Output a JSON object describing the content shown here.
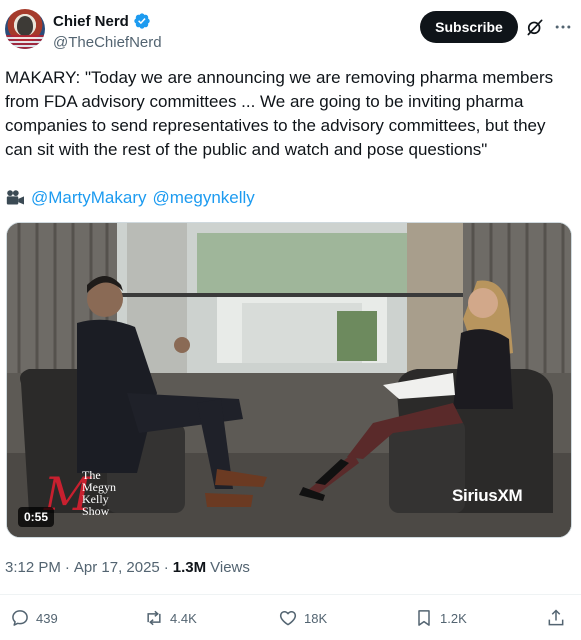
{
  "author": {
    "display_name": "Chief Nerd",
    "handle": "@TheChiefNerd",
    "verified_icon": "verified-badge-icon",
    "avatar_icon": "avatar"
  },
  "header": {
    "subscribe_label": "Subscribe",
    "grok_icon": "grok-icon",
    "more_icon": "more-icon"
  },
  "tweet": {
    "text": "MAKARY: \"Today we are announcing we are removing pharma members from FDA advisory committees ... We are going to be inviting pharma companies to send representatives to the advisory committees, but they can sit with the rest of the public and watch and pose questions\"",
    "camera_icon": "movie-camera-icon",
    "mention_1": "@MartyMakary",
    "mention_2": "@megynkelly"
  },
  "media": {
    "duration": "0:55",
    "show_logo_the": "The",
    "show_logo_megyn": "Megyn",
    "show_logo_kelly": "Kelly",
    "show_logo_show": "Show",
    "show_logo_m": "M",
    "watermark": "SiriusXM"
  },
  "meta": {
    "time": "3:12 PM",
    "separator": "·",
    "date": "Apr 17, 2025",
    "views_count": "1.3M",
    "views_label": "Views"
  },
  "actions": {
    "replies": "439",
    "reposts": "4.4K",
    "likes": "18K",
    "bookmarks": "1.2K"
  },
  "colors": {
    "link": "#1d9bf0",
    "verified": "#1d9bf0",
    "secondary_text": "#536471",
    "primary_text": "#0f1419"
  }
}
